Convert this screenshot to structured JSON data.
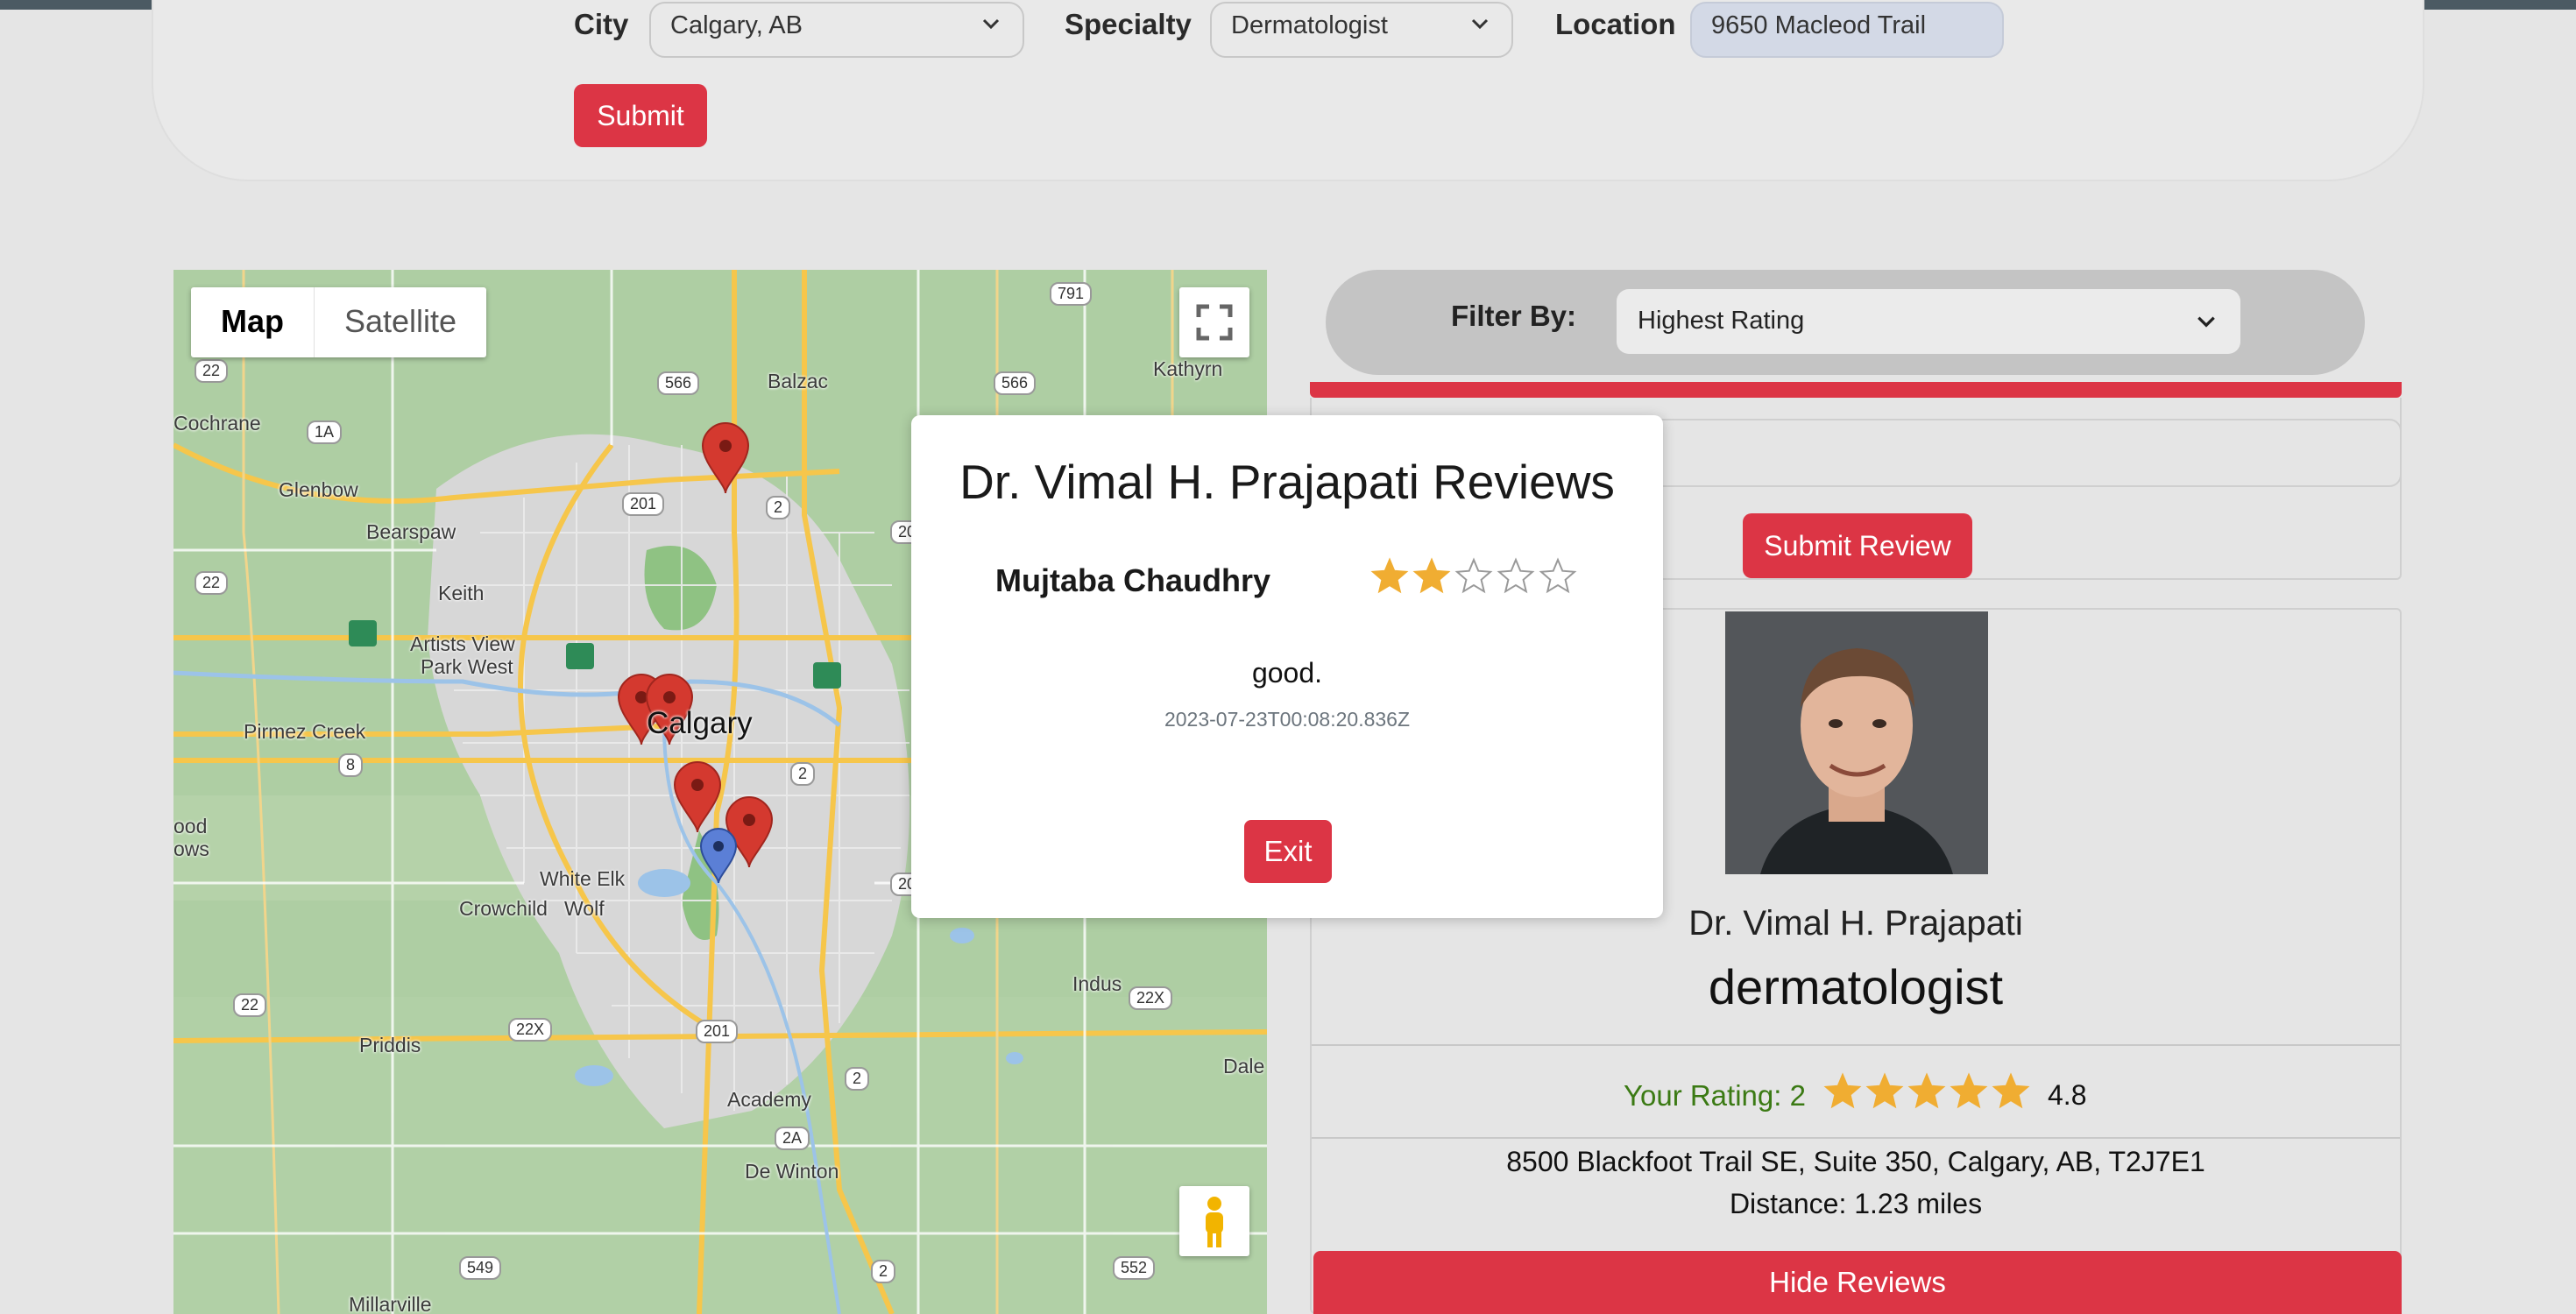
{
  "search": {
    "city_label": "City",
    "city_value": "Calgary, AB",
    "specialty_label": "Specialty",
    "specialty_value": "Dermatologist",
    "location_label": "Location",
    "location_value": "9650 Macleod Trail",
    "submit_label": "Submit"
  },
  "map": {
    "toggle_map": "Map",
    "toggle_satellite": "Satellite",
    "labels": {
      "cochrane": "Cochrane",
      "glenbow": "Glenbow",
      "bearspaw": "Bearspaw",
      "keith": "Keith",
      "artists_view": "Artists View",
      "park_west": "Park West",
      "pirmez_creek": "Pirmez Creek",
      "calgary": "Calgary",
      "balzac": "Balzac",
      "kathyrn": "Kathyrn",
      "white_elk": "White Elk",
      "crowchild": "Crowchild",
      "wolf": "Wolf",
      "priddis": "Priddis",
      "indus": "Indus",
      "dale": "Dale",
      "academy": "Academy",
      "de_winton": "De Winton",
      "millarville": "Millarville",
      "ood": "ood",
      "ows": "ows"
    },
    "shields": {
      "h791": "791",
      "h566a": "566",
      "h566b": "566",
      "h22a": "22",
      "h1a": "1A",
      "h201a": "201",
      "h2a": "2",
      "h22b": "22",
      "h8": "8",
      "h2b": "2",
      "h22c": "22",
      "h22xa": "22X",
      "h201b": "201",
      "h22xb": "22X",
      "h2c": "2",
      "h2a_b": "2A",
      "h549": "549",
      "h2d": "2",
      "h552": "552",
      "h20a": "20",
      "h20b": "20"
    }
  },
  "filter": {
    "label": "Filter By:",
    "value": "Highest Rating"
  },
  "review_form": {
    "submit_label": "Submit Review"
  },
  "doctor": {
    "name": "Dr. Vimal H. Prajapati",
    "specialty": "dermatologist",
    "your_rating_label": "Your Rating: 2",
    "average_rating": "4.8",
    "average_stars": 5,
    "address": "8500 Blackfoot Trail SE, Suite 350, Calgary, AB, T2J7E1",
    "distance": "Distance: 1.23 miles",
    "hide_reviews_label": "Hide Reviews"
  },
  "modal": {
    "title": "Dr. Vimal H. Prajapati Reviews",
    "reviewer": "Mujtaba Chaudhry",
    "rating": 2,
    "rating_max": 5,
    "text": "good.",
    "date": "2023-07-23T00:08:20.836Z",
    "exit_label": "Exit"
  },
  "colors": {
    "accent": "#dc3545",
    "star": "#f0ad32",
    "rating_text": "#3b7a14"
  }
}
